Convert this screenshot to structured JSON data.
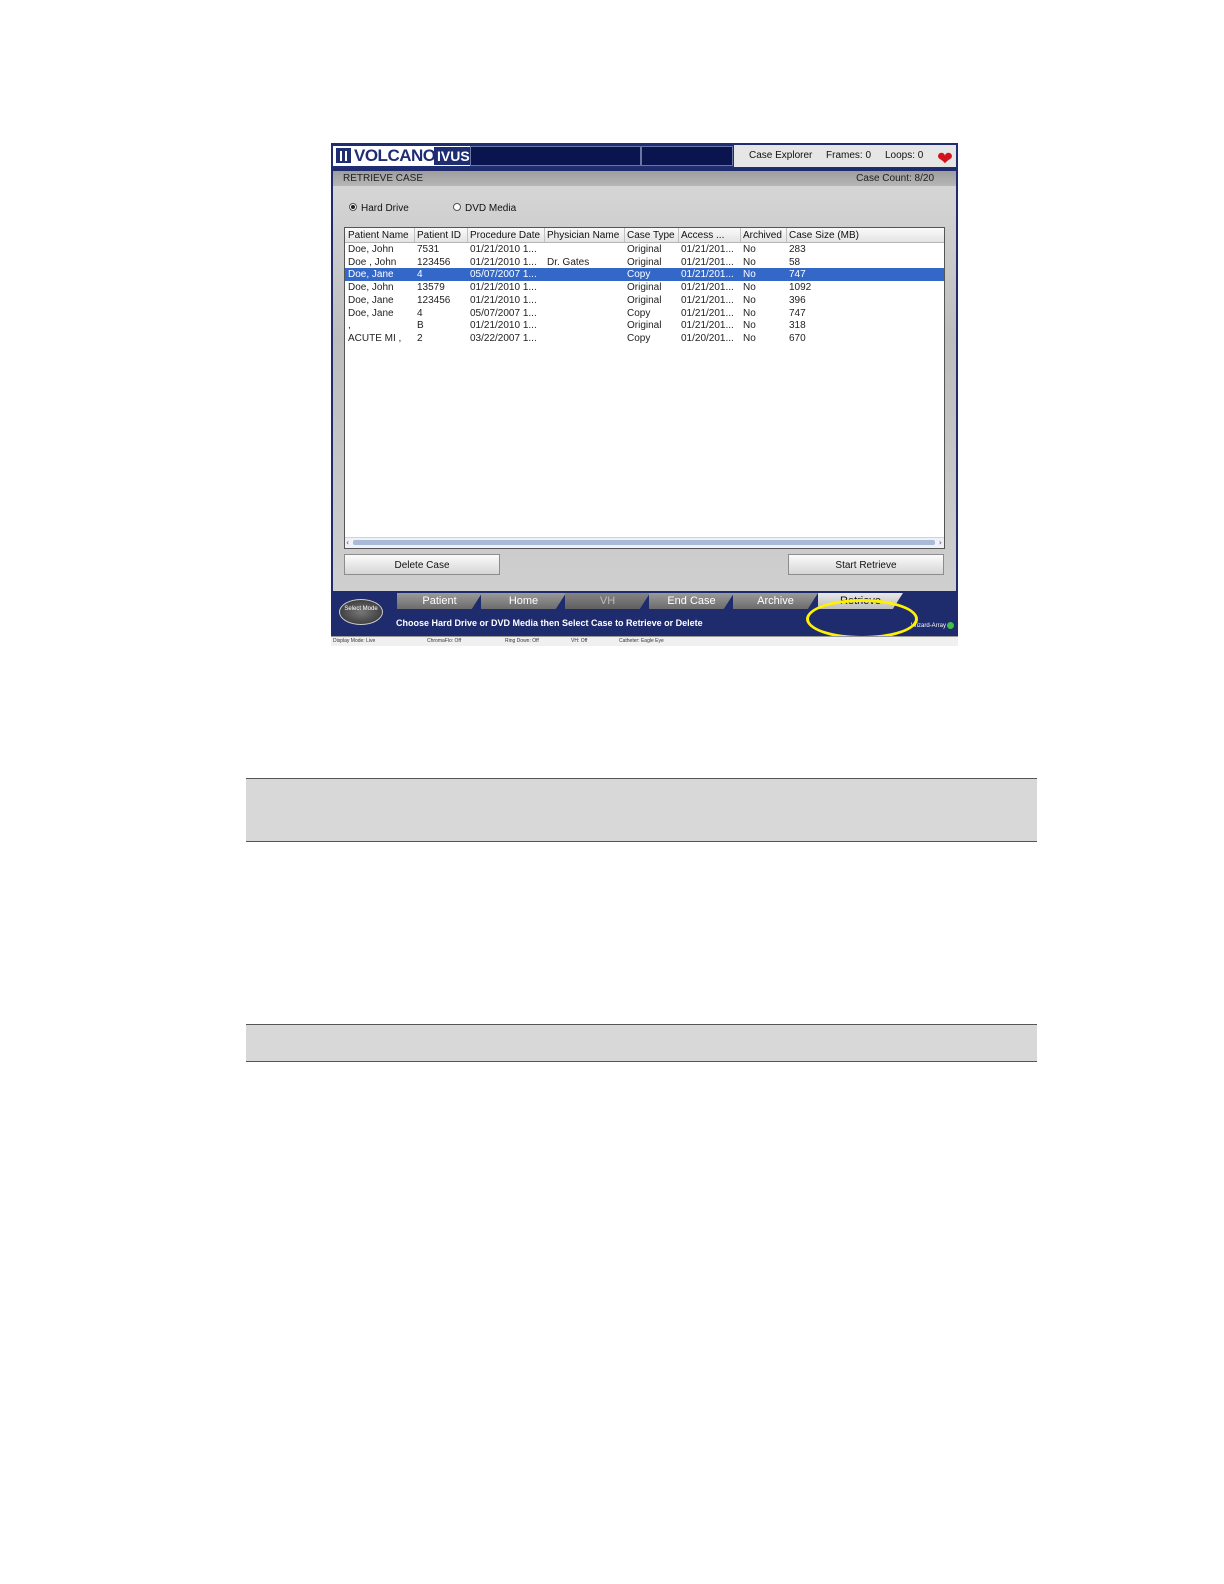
{
  "header": {
    "logo_brand": "VOLCANO",
    "logo_product": "IVUS",
    "screen_name": "Case Explorer",
    "frames": "Frames: 0",
    "loops": "Loops: 0",
    "heart_icon": "heart-icon"
  },
  "panel": {
    "title": "RETRIEVE CASE",
    "case_count": "Case Count: 8/20",
    "source_options": [
      {
        "label": "Hard Drive",
        "selected": true
      },
      {
        "label": "DVD Media",
        "selected": false
      }
    ]
  },
  "table": {
    "columns": [
      "Patient Name",
      "Patient ID",
      "Procedure Date",
      "Physician Name",
      "Case Type",
      "Access ...",
      "Archived",
      "Case Size (MB)"
    ],
    "selected_row": 2,
    "rows": [
      [
        "Doe, John",
        "7531",
        "01/21/2010 1...",
        "",
        "Original",
        "01/21/201...",
        "No",
        "283"
      ],
      [
        "Doe , John",
        "123456",
        "01/21/2010 1...",
        "Dr. Gates",
        "Original",
        "01/21/201...",
        "No",
        "58"
      ],
      [
        "Doe, Jane",
        "4",
        "05/07/2007 1...",
        "",
        "Copy",
        "01/21/201...",
        "No",
        "747"
      ],
      [
        "Doe, John",
        "13579",
        "01/21/2010 1...",
        "",
        "Original",
        "01/21/201...",
        "No",
        "1092"
      ],
      [
        "Doe, Jane",
        "123456",
        "01/21/2010 1...",
        "",
        "Original",
        "01/21/201...",
        "No",
        "396"
      ],
      [
        "Doe, Jane",
        "4",
        "05/07/2007 1...",
        "",
        "Copy",
        "01/21/201...",
        "No",
        "747"
      ],
      [
        ",",
        "B",
        "01/21/2010 1...",
        "",
        "Original",
        "01/21/201...",
        "No",
        "318"
      ],
      [
        "ACUTE MI ,",
        "2",
        "03/22/2007 1...",
        "",
        "Copy",
        "01/20/201...",
        "No",
        "670"
      ]
    ]
  },
  "buttons": {
    "delete_case": "Delete Case",
    "start_retrieve": "Start Retrieve"
  },
  "tabbar": {
    "mode_button": "Select Mode",
    "tabs": [
      {
        "label": "Patient",
        "state": "normal"
      },
      {
        "label": "Home",
        "state": "normal"
      },
      {
        "label": "VH",
        "state": "disabled"
      },
      {
        "label": "End Case",
        "state": "normal"
      },
      {
        "label": "Archive",
        "state": "normal"
      },
      {
        "label": "Retrieve",
        "state": "active"
      }
    ],
    "instruction": "Choose Hard Drive or DVD Media then Select Case to Retrieve or Delete",
    "wizard": "Wizard-Array"
  },
  "statusbar": [
    "Display Mode: Live",
    "ChromaFlo: Off",
    "Ring Down: Off",
    "VH: Off",
    "Catheter: Eagle Eye"
  ],
  "colors": {
    "app_background": "#1e2b6d",
    "selection": "#3468c8",
    "highlight_ring": "#fff200",
    "heart": "#d3121a"
  }
}
